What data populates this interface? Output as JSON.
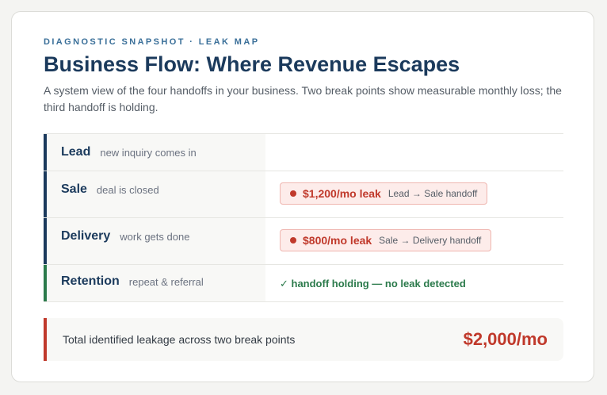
{
  "header": {
    "eyebrow": "DIAGNOSTIC SNAPSHOT · LEAK MAP",
    "title": "Business Flow: Where Revenue Escapes",
    "subtitle": "A system view of the four handoffs in your business. Two break points show measurable monthly loss; the third handoff is holding."
  },
  "stages": [
    {
      "name": "Lead",
      "description": "new inquiry comes in"
    },
    {
      "name": "Sale",
      "description": "deal is closed"
    },
    {
      "name": "Delivery",
      "description": "work gets done"
    },
    {
      "name": "Retention",
      "description": "repeat & referral"
    }
  ],
  "leaks": [
    {
      "amount": "$1,200/mo leak",
      "handoff": "Lead → Sale handoff"
    },
    {
      "amount": "$800/mo leak",
      "handoff": "Sale → Delivery handoff"
    }
  ],
  "holding": {
    "text": "✓ handoff holding — no leak detected"
  },
  "total": {
    "label": "Total identified leakage across two break points",
    "value": "$2,000/mo"
  },
  "colors": {
    "navy": "#1b3a5c",
    "leak_red": "#c0392b",
    "holding_green": "#2b7a4b",
    "eyebrow_blue": "#3a6f99"
  }
}
